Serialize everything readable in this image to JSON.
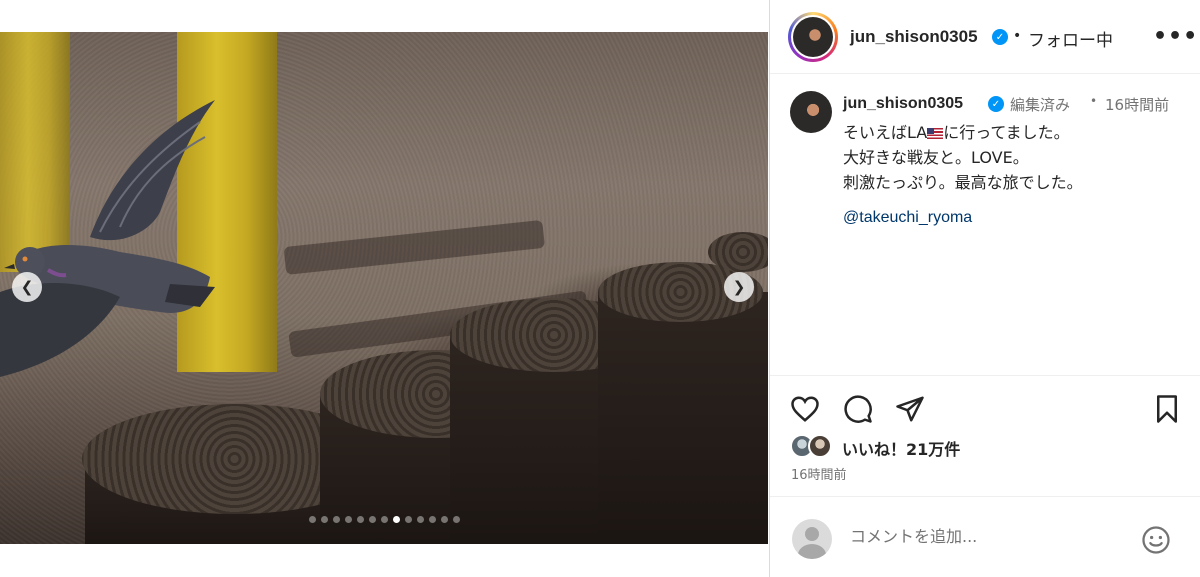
{
  "post": {
    "username": "jun_shison0305",
    "verified_icon": "verified-badge-icon",
    "follow_state": "フォロー中",
    "header_separator": "•",
    "more_icon": "more-options-icon"
  },
  "media": {
    "carousel_total": 13,
    "carousel_active_index": 7,
    "prev_icon": "chevron-left-icon",
    "next_icon": "chevron-right-icon"
  },
  "caption": {
    "username": "jun_shison0305",
    "edited": "編集済み",
    "separator": "•",
    "time": "16時間前",
    "line1_before_flag": "そいえばLA",
    "line1_after_flag": "に行ってました。",
    "line2": "大好きな戦友と。LOVE。",
    "line3": "刺激たっぷり。最高な旅でした。",
    "mention": "@takeuchi_ryoma"
  },
  "actions": {
    "like_icon": "heart-icon",
    "comment_icon": "comment-icon",
    "share_icon": "share-icon",
    "save_icon": "bookmark-icon",
    "likes_text": "いいね！21万件",
    "posted_time": "16時間前"
  },
  "comment": {
    "placeholder": "コメントを追加...",
    "emoji_icon": "emoji-icon"
  },
  "colors": {
    "verified": "#0095f6",
    "mention": "#00376b",
    "muted": "#737373",
    "text": "#262626"
  }
}
